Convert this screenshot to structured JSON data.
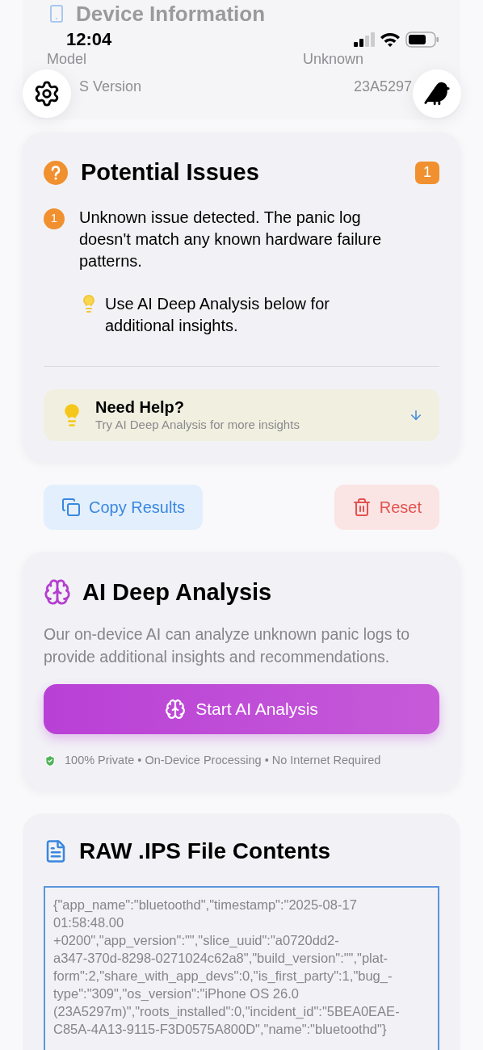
{
  "status_bar": {
    "time": "12:04"
  },
  "background_card": {
    "title": "Device Information",
    "rows": [
      {
        "label": "Model",
        "value": "Unknown"
      },
      {
        "label": "S Version",
        "value": "23A5297"
      }
    ]
  },
  "issues_card": {
    "title": "Potential Issues",
    "count": "1",
    "issues": [
      {
        "number": "1",
        "text": "Unknown issue detected. The panic log doesn't match any known hardware failure patterns.",
        "tip": "Use AI Deep Analysis below for additional insights."
      }
    ],
    "help": {
      "title": "Need Help?",
      "subtitle": "Try AI Deep Analysis for more insights"
    }
  },
  "actions": [
    {
      "kind": "copy",
      "label": "Copy Results"
    },
    {
      "kind": "reset",
      "label": "Reset"
    }
  ],
  "ai_card": {
    "title": "AI Deep Analysis",
    "description": "Our on-device AI can analyze unknown panic logs to provide additional insights and recommendations.",
    "button": "Start AI Analysis",
    "privacy": "100% Private • On-Device Processing • No Internet Required"
  },
  "raw_card": {
    "title": "RAW .IPS File Contents",
    "lines": [
      "{\"app_name\":\"bluetoothd\",\"timestamp\":\"2025-08-17",
      "01:58:48.00",
      "+0200\",\"app_version\":\"\",\"slice_uuid\":\"a0720dd2-",
      "a347-370d-8298-0271024c62a8\",\"build_version\":\"\",\"plat-",
      "form\":2,\"share_with_app_devs\":0,\"is_first_party\":1,\"bug_-",
      "type\":\"309\",\"os_version\":\"iPhone OS 26.0",
      "(23A5297m)\",\"roots_installed\":0,\"incident_id\":\"5BEA0EAE-",
      "C85A-4A13-9115-F3D0575A800D\",\"name\":\"bluetoothd\"}"
    ]
  }
}
